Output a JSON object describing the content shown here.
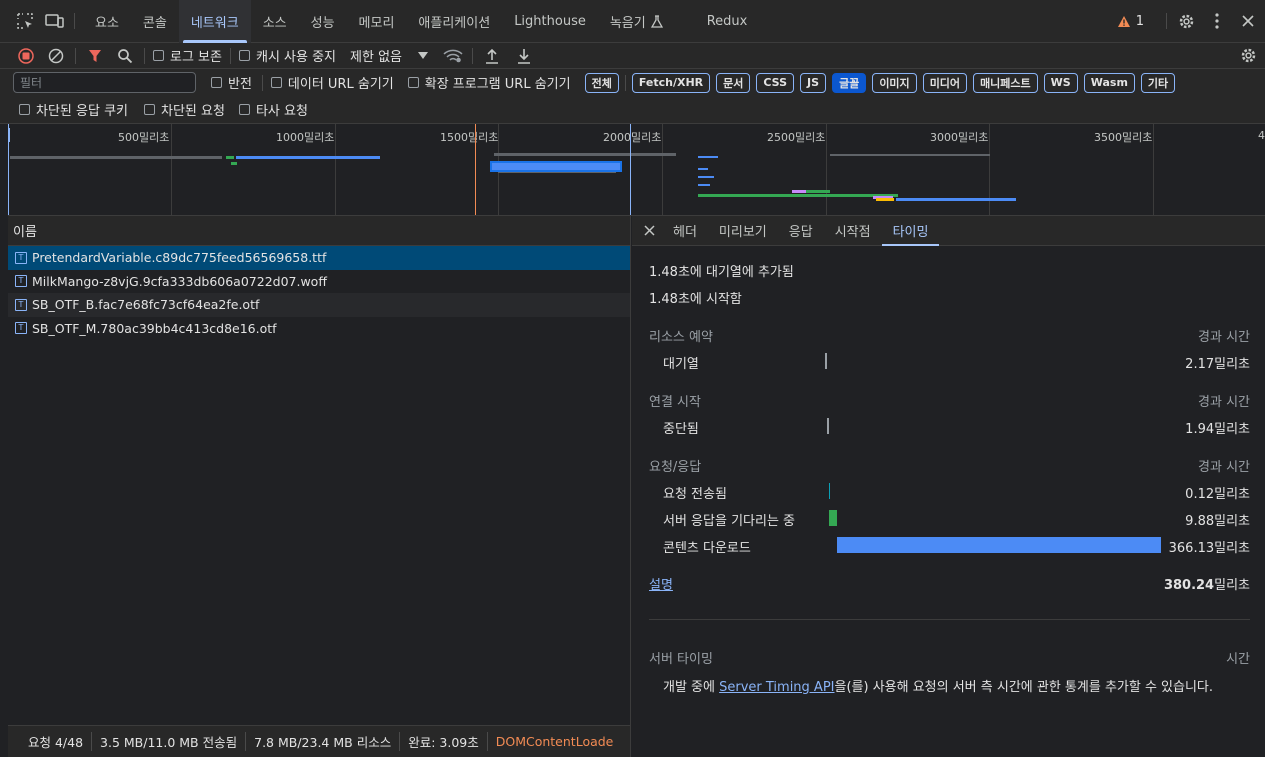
{
  "top_tabs": [
    "요소",
    "콘솔",
    "네트워크",
    "소스",
    "성능",
    "메모리",
    "애플리케이션",
    "Lighthouse",
    "녹음기",
    "Redux"
  ],
  "active_top_tab": "네트워크",
  "warning_count": "1",
  "toolbar": {
    "preserve_log": "로그 보존",
    "disable_cache": "캐시 사용 중지",
    "throttle": "제한 없음"
  },
  "filter": {
    "placeholder": "필터",
    "invert": "반전",
    "hide_data_urls": "데이터 URL 숨기기",
    "hide_extension_urls": "확장 프로그램 URL 숨기기",
    "types": [
      "전체",
      "Fetch/XHR",
      "문서",
      "CSS",
      "JS",
      "글꼴",
      "이미지",
      "미디어",
      "매니페스트",
      "WS",
      "Wasm",
      "기타"
    ],
    "selected_type": "글꼴",
    "blocked_cookies": "차단된 응답 쿠키",
    "blocked_requests": "차단된 요청",
    "third_party": "타사 요청"
  },
  "overview_ticks": [
    "500밀리초",
    "1000밀리초",
    "1500밀리초",
    "2000밀리초",
    "2500밀리초",
    "3000밀리초",
    "3500밀리초",
    "4"
  ],
  "column_header": "이름",
  "requests": [
    {
      "name": "PretendardVariable.c89dc775feed56569658.ttf"
    },
    {
      "name": "MilkMango-z8vjG.9cfa333db606a0722d07.woff"
    },
    {
      "name": "SB_OTF_B.fac7e68fc73cf64ea2fe.otf"
    },
    {
      "name": "SB_OTF_M.780ac39bb4c413cd8e16.otf"
    }
  ],
  "status": {
    "requests": "요청 4/48",
    "transferred": "3.5 MB/11.0 MB 전송됨",
    "resources": "7.8 MB/23.4 MB 리소스",
    "finish": "완료: 3.09초",
    "dcl": "DOMContentLoade"
  },
  "detail_tabs": [
    "헤더",
    "미리보기",
    "응답",
    "시작점",
    "타이밍"
  ],
  "active_detail_tab": "타이밍",
  "timing": {
    "queued_at": "1.48초에 대기열에 추가됨",
    "started_at": "1.48초에 시작함",
    "sections": [
      {
        "title": "리소스 예약",
        "col": "경과 시간",
        "rows": [
          {
            "label": "대기열",
            "value": "2.17밀리초",
            "ms": 2.17,
            "color": "#9aa0a6"
          }
        ]
      },
      {
        "title": "연결 시작",
        "col": "경과 시간",
        "rows": [
          {
            "label": "중단됨",
            "value": "1.94밀리초",
            "ms": 1.94,
            "color": "#9aa0a6"
          }
        ]
      },
      {
        "title": "요청/응답",
        "col": "경과 시간",
        "rows": [
          {
            "label": "요청 전송됨",
            "value": "0.12밀리초",
            "ms": 0.12,
            "color": "#0b9fb5"
          },
          {
            "label": "서버 응답을 기다리는 중",
            "value": "9.88밀리초",
            "ms": 9.88,
            "color": "#34a853"
          },
          {
            "label": "콘텐츠 다운로드",
            "value": "366.13밀리초",
            "ms": 366.13,
            "color": "#4c8bf5"
          }
        ]
      }
    ],
    "explanation_link": "설명",
    "total_value": "380.24",
    "total_unit": "밀리초",
    "server_timing_title": "서버 타이밍",
    "server_timing_col": "시간",
    "server_timing_pre": "개발 중에 ",
    "server_timing_link": "Server Timing API",
    "server_timing_post": "을(를) 사용해 요청의 서버 측 시간에 관한 통계를 추가할 수 있습니다."
  }
}
